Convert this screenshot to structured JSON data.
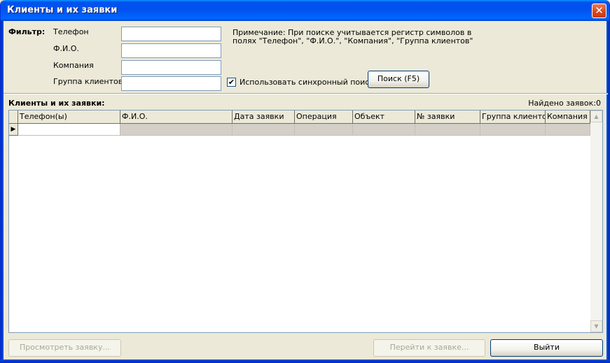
{
  "window": {
    "title": "Клиенты и их заявки",
    "close_glyph": "✕"
  },
  "filter": {
    "label": "Фильтр:",
    "phone_label": "Телефон",
    "fio_label": "Ф.И.О.",
    "company_label": "Компания",
    "group_label": "Группа клиентов",
    "phone_value": "",
    "fio_value": "",
    "company_value": "",
    "group_value": "",
    "note_line1": "Примечание: При поиске учитывается регистр символов в",
    "note_line2": "полях \"Телефон\", \"Ф.И.О.\", \"Компания\", \"Группа клиентов\"",
    "sync_search_label": "Использовать синхронный поиск",
    "sync_search_checked": true,
    "checkmark": "✔",
    "search_button": "Поиск (F5)"
  },
  "list": {
    "title": "Клиенты и их заявки:",
    "found_label": "Найдено заявок:",
    "found_count": "0",
    "columns": [
      "Телефон(ы)",
      "Ф.И.О.",
      "Дата заявки",
      "Операция",
      "Объект",
      "№ заявки",
      "Группа клиентов",
      "Компания"
    ],
    "row_indicator": "▶",
    "scroll_up_glyph": "▲",
    "scroll_down_glyph": "▼"
  },
  "footer": {
    "view_button": "Просмотреть заявку...",
    "goto_button": "Перейти к заявке...",
    "exit_button": "Выйти"
  }
}
